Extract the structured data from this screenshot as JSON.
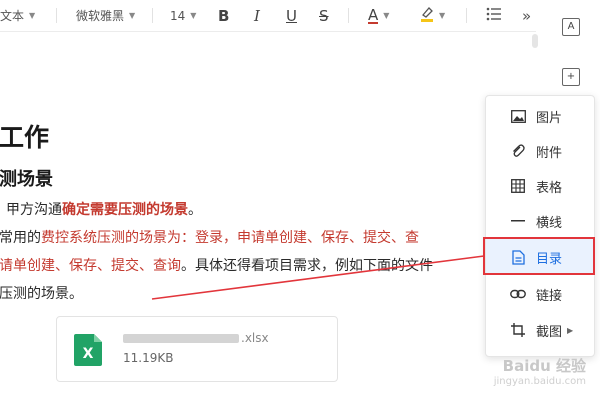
{
  "toolbar": {
    "style_label": "文本",
    "font_name": "微软雅黑",
    "font_size": "14",
    "bold": "B",
    "italic": "I",
    "underline": "U",
    "strike": "S",
    "font_color": "A",
    "more": "»"
  },
  "document": {
    "heading": "工作",
    "subheading": "测场景",
    "p1_prefix": "甲方沟通",
    "p1_highlight": "确定需要压测的场景",
    "p1_suffix": "。",
    "p2_prefix": "常用的",
    "p2_red1": "费控系统压测的场景为：",
    "p2_red2": "登录，申请单创建、保存、提交、查",
    "p3_red": "请单创建、保存、提交、查询",
    "p3_suffix": "。具体还得看项目需求，例如下面的文件",
    "p4": "压测的场景。",
    "attachment": {
      "name_suffix": ".xlsx",
      "size": "11.19KB",
      "icon_letter": "X"
    }
  },
  "rail": {
    "btn1": "A",
    "btn2": "+"
  },
  "menu": {
    "items": [
      {
        "label": "图片",
        "icon": "image-icon"
      },
      {
        "label": "附件",
        "icon": "paperclip-icon"
      },
      {
        "label": "表格",
        "icon": "table-icon"
      },
      {
        "label": "横线",
        "icon": "horizontal-line-icon"
      },
      {
        "label": "目录",
        "icon": "document-icon"
      },
      {
        "label": "链接",
        "icon": "link-icon"
      },
      {
        "label": "截图",
        "icon": "crop-icon"
      }
    ],
    "active_index": 4
  },
  "watermark": {
    "brand": "Baidu 经验",
    "domain": "jingyan.baidu.com"
  },
  "colors": {
    "accent_red": "#c43a2f",
    "highlight_border": "#e2353b",
    "active_blue": "#1e6fe0",
    "excel_green": "#21a366"
  }
}
